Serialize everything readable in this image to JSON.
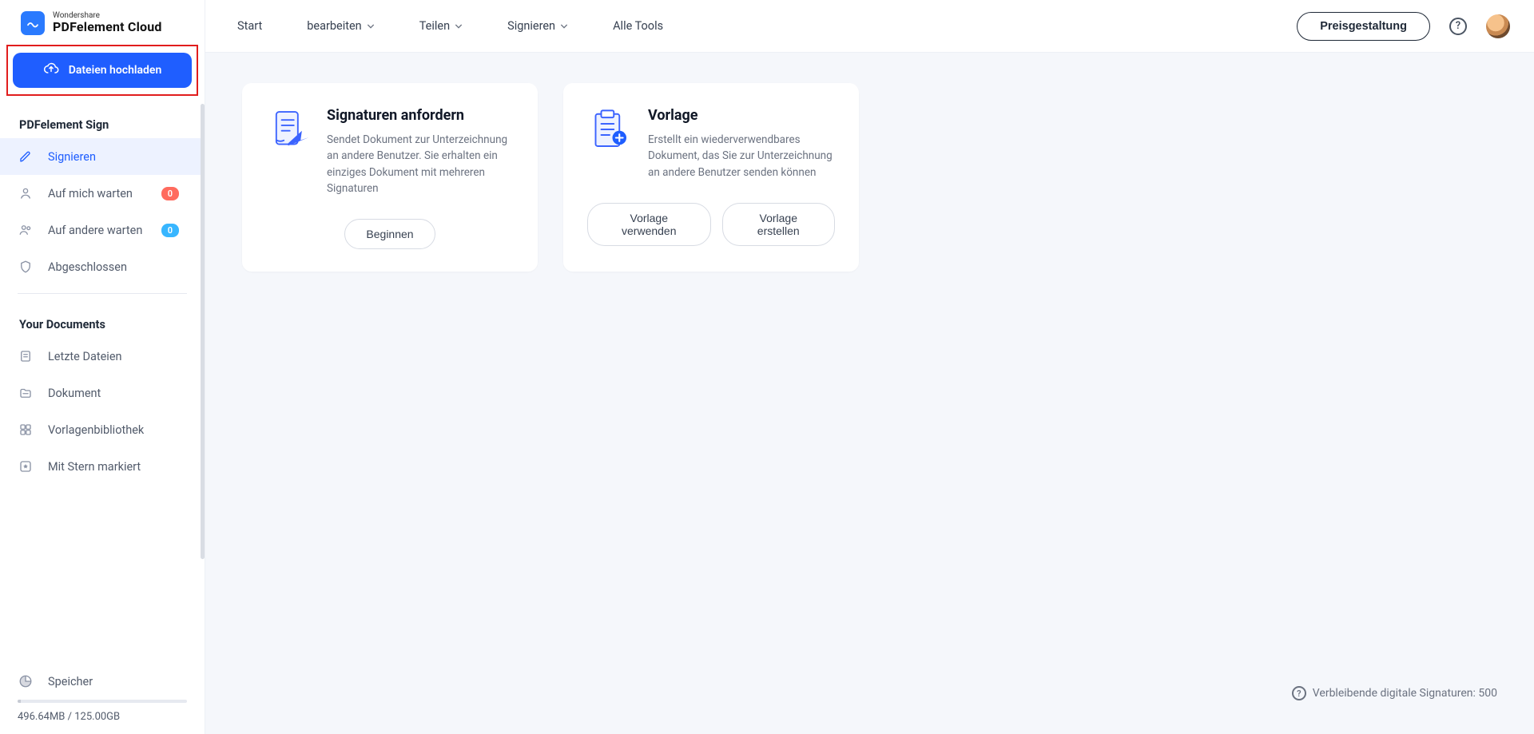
{
  "brand": {
    "small": "Wondershare",
    "big": "PDFelement Cloud"
  },
  "upload_label": "Dateien hochladen",
  "sidebar": {
    "section_sign": "PDFelement Sign",
    "items_sign": [
      {
        "label": "Signieren"
      },
      {
        "label": "Auf mich warten",
        "badge": "0"
      },
      {
        "label": "Auf andere warten",
        "badge": "0"
      },
      {
        "label": "Abgeschlossen"
      }
    ],
    "section_docs": "Your Documents",
    "items_docs": [
      {
        "label": "Letzte Dateien"
      },
      {
        "label": "Dokument"
      },
      {
        "label": "Vorlagenbibliothek"
      },
      {
        "label": "Mit Stern markiert"
      }
    ],
    "storage_label": "Speicher",
    "storage_text": "496.64MB / 125.00GB"
  },
  "topnav": {
    "items": [
      {
        "label": "Start"
      },
      {
        "label": "bearbeiten"
      },
      {
        "label": "Teilen"
      },
      {
        "label": "Signieren"
      },
      {
        "label": "Alle Tools"
      }
    ],
    "pricing": "Preisgestaltung"
  },
  "cards": {
    "request": {
      "title": "Signaturen anfordern",
      "desc": "Sendet Dokument zur Unterzeichnung an andere Benutzer. Sie erhalten ein einziges Dokument mit mehreren Signaturen",
      "cta": "Beginnen"
    },
    "template": {
      "title": "Vorlage",
      "desc": "Erstellt ein wiederverwendbares Dokument, das Sie zur Unterzeichnung an andere Benutzer senden können",
      "cta_use": "Vorlage verwenden",
      "cta_create": "Vorlage erstellen"
    }
  },
  "footer": {
    "remaining": "Verbleibende digitale Signaturen: 500"
  }
}
